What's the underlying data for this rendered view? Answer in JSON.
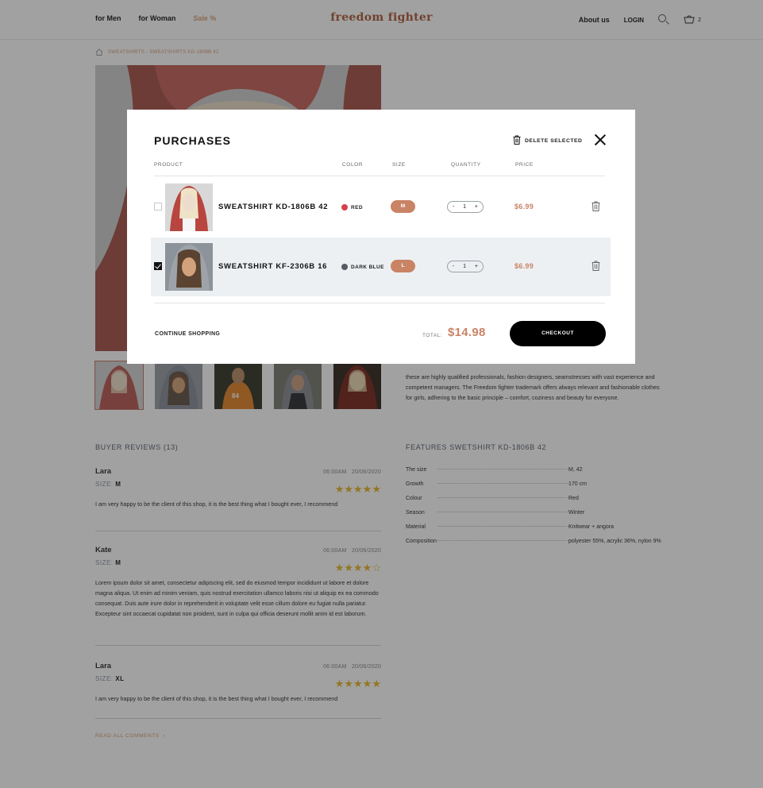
{
  "header": {
    "nav_left": [
      "for Men",
      "for Woman",
      "Sale %"
    ],
    "logo": "freedom fighter",
    "about": "About us",
    "login": "LOGIN",
    "cart_count": "2"
  },
  "breadcrumb": {
    "text": "SWEATSHIRTS - SWEATSHIRTS KD-1806B 42"
  },
  "description": "these are highly qualified professionals, fashion designers, seamstresses with vast experience and competent managers. The Freedom fighter trademark offers always relevant and fashionable clothes for girls, adhering to the basic principle – comfort, coziness and beauty for everyone.",
  "reviews": {
    "title": "BUYER REVIEWS (13)",
    "size_label": "SIZE:",
    "items": [
      {
        "name": "Lara",
        "time": "06:00AM",
        "date": "20/06/2020",
        "size": "M",
        "stars": "★★★★★",
        "text": "I am very happy to be the client of this shop, it is the best thing what I bought ever, I recommend"
      },
      {
        "name": "Kate",
        "time": "06:00AM",
        "date": "20/06/2020",
        "size": "M",
        "stars": "★★★★☆",
        "text": "Lorem ipsum dolor sit amet, consectetur adipiscing elit, sed do eiusmod tempor incididunt ut labore et dolore magna aliqua. Ut enim ad minim veniam, quis nostrud exercitation ullamco laboris nisi ut aliquip ex ea commodo consequat. Duis aute irure dolor in reprehenderit in voluptate velit esse cillum dolore eu fugiat nulla pariatur. Excepteur sint occaecat cupidatat non proident, sunt in culpa qui officia deserunt mollit anim id est laborum."
      },
      {
        "name": "Lara",
        "time": "06:00AM",
        "date": "20/06/2020",
        "size": "XL",
        "stars": "★★★★★",
        "text": "I am very happy to be the client of this shop, it is the best thing what I bought ever, I recommend"
      }
    ],
    "read_all": "READ ALL COMMENTS"
  },
  "features": {
    "title": "FEATURES SWETSHIRT KD-1806B 42",
    "rows": [
      {
        "key": "The size",
        "value": "M, 42"
      },
      {
        "key": "Growth",
        "value": "170 cm"
      },
      {
        "key": "Colour",
        "value": "Red"
      },
      {
        "key": "Season",
        "value": "Winter"
      },
      {
        "key": "Material",
        "value": "Knitwear + angora"
      },
      {
        "key": "Composition",
        "value": "polyester 55%, acrylic 36%, nylon 9%"
      }
    ]
  },
  "modal": {
    "title": "PURCHASES",
    "delete_selected": "DELETE SELECTED",
    "columns": {
      "product": "PRODUCT",
      "color": "COLOR",
      "size": "SIZE",
      "quantity": "QUANTITY",
      "price": "PRICE"
    },
    "items": [
      {
        "name": "SWEATSHIRT KD-1806B 42",
        "checked": false,
        "color_name": "RED",
        "color_hex": "#d6414b",
        "size": "M",
        "qty": "1",
        "minus": "-",
        "plus": "+",
        "price": "$6.99"
      },
      {
        "name": "SWEATSHIRT KF-2306B 16",
        "checked": true,
        "color_name": "DARK BLUE",
        "color_hex": "#555a63",
        "size": "L",
        "qty": "1",
        "minus": "-",
        "plus": "+",
        "price": "$6.99"
      }
    ],
    "continue": "CONTINUE SHOPPING",
    "total_label": "TOTAL:",
    "total_value": "$14.98",
    "checkout": "CHECKOUT"
  },
  "colors": {
    "accent": "#c98365",
    "brand": "#b0603f",
    "overlay": "rgba(20,20,20,0.40)",
    "stars": "#e8b730"
  }
}
